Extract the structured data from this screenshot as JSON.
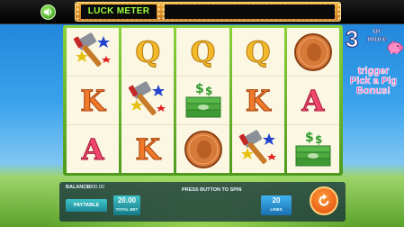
{
  "top_bar": {
    "sound_icon": "speaker-icon",
    "luck_meter_label": "LUCK METER",
    "luck_meter_level": 0
  },
  "reels": [
    [
      "hammer",
      "K",
      "A"
    ],
    [
      "Q",
      "hammer",
      "K"
    ],
    [
      "Q",
      "money",
      "penny"
    ],
    [
      "Q",
      "K",
      "hammer"
    ],
    [
      "penny",
      "A",
      "money"
    ]
  ],
  "promo": {
    "count": "3",
    "more": "or more",
    "text": "trigger Pick a Pig Bonus!",
    "icon": "pig-icon"
  },
  "panel": {
    "balance_label": "BALANCE:",
    "balance_value": "1000.00",
    "hint": "PRESS BUTTON TO SPIN",
    "paytable_label": "PAYTABLE",
    "total_bet_value": "20.00",
    "total_bet_label": "TOTAL BET",
    "lines_value": "20",
    "lines_label": "LINES",
    "spin_icon": "spin-arrow-icon"
  },
  "colors": {
    "meter_green": "#9dff3d",
    "frame_green": "#6fbf2c",
    "reel_bg": "#fbf7e3",
    "spin_orange": "#e04a0a"
  }
}
